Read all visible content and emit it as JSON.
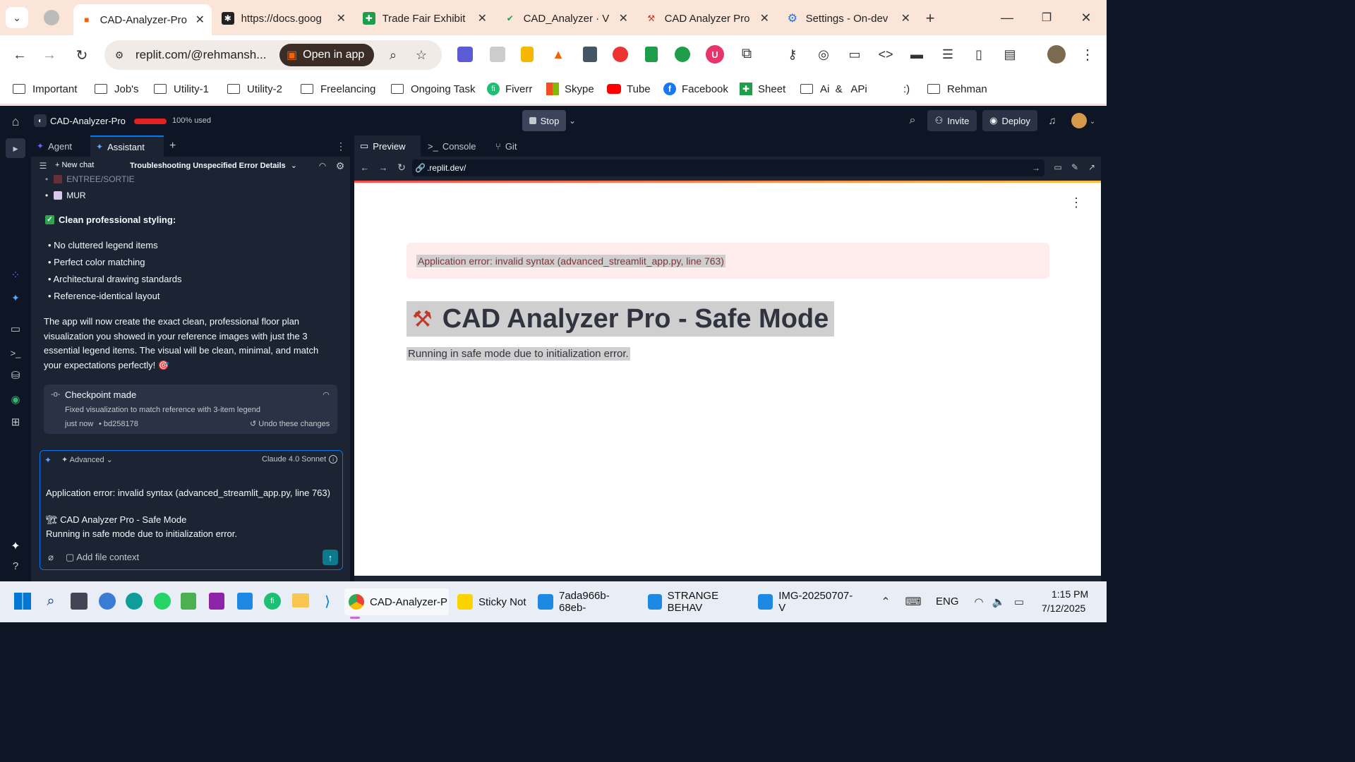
{
  "browser": {
    "tabs": [
      {
        "title": "CAD-Analyzer-Pro",
        "favicon": "replit-icon",
        "active": true
      },
      {
        "title": "https://docs.goog",
        "favicon": "dots-icon"
      },
      {
        "title": "Trade Fair Exhibit",
        "favicon": "sheets-icon"
      },
      {
        "title": "CAD_Analyzer · V",
        "favicon": "check-icon"
      },
      {
        "title": "CAD Analyzer Pro",
        "favicon": "crane-icon"
      },
      {
        "title": "Settings - On-dev",
        "favicon": "gear-icon"
      }
    ],
    "url": "replit.com/@rehmansh...",
    "open_in_app": "Open in app",
    "bookmarks": [
      {
        "label": "Important",
        "icon": "folder-icon"
      },
      {
        "label": "Job's",
        "icon": "folder-icon"
      },
      {
        "label": "Utility-1",
        "icon": "folder-icon"
      },
      {
        "label": "Utility-2",
        "icon": "folder-icon"
      },
      {
        "label": "Freelancing",
        "icon": "folder-icon"
      },
      {
        "label": "Ongoing Task",
        "icon": "folder-icon"
      },
      {
        "label": "Fiverr",
        "icon": "fiverr-icon"
      },
      {
        "label": "Skype",
        "icon": "windows-icon"
      },
      {
        "label": "Tube",
        "icon": "youtube-icon"
      },
      {
        "label": "Facebook",
        "icon": "facebook-icon"
      },
      {
        "label": "Sheet",
        "icon": "sheets-icon"
      },
      {
        "label": "Ai  &   APi",
        "icon": "folder-icon"
      },
      {
        "label": ":)",
        "icon": ""
      },
      {
        "label": "Rehman",
        "icon": "folder-icon"
      }
    ]
  },
  "replit": {
    "project": "CAD-Analyzer-Pro",
    "usage": "100% used",
    "stop": "Stop",
    "invite": "Invite",
    "deploy": "Deploy",
    "left_tabs": {
      "agent": "Agent",
      "assistant": "Assistant",
      "add": "+"
    },
    "new_chat": "+ New chat",
    "chat_title": "Troubleshooting Unspecified Error Details",
    "chat": {
      "list_top": [
        "ENTREE/SORTIE",
        "MUR"
      ],
      "styling_heading": "Clean professional styling:",
      "styling_items": [
        "No cluttered legend items",
        "Perfect color matching",
        "Architectural drawing standards",
        "Reference-identical layout"
      ],
      "paragraph": "The app will now create the exact clean, professional floor plan visualization you showed in your reference images with just the 3 essential legend items. The visual will be clean, minimal, and match your expectations perfectly! 🎯",
      "checkpoint_title": "Checkpoint made",
      "checkpoint_desc": "Fixed visualization to match reference with 3-item legend",
      "checkpoint_time": "just now",
      "checkpoint_hash": "• bd258178",
      "undo": "Undo these changes"
    },
    "composer": {
      "mode": "Advanced",
      "model": "Claude 4.0 Sonnet",
      "line1": "Application error: invalid syntax (advanced_streamlit_app.py, line 763)",
      "line2": "🏗 CAD Analyzer Pro - Safe Mode",
      "line3": "Running in safe mode due to initialization error.",
      "add_context": "Add file context"
    },
    "right_tabs": {
      "preview": "Preview",
      "console": "Console",
      "git": "Git"
    },
    "preview_url": ".replit.dev/",
    "preview": {
      "error": "Application error: invalid syntax (advanced_streamlit_app.py, line 763)",
      "title": "CAD Analyzer Pro - Safe Mode",
      "subtitle": "Running in safe mode due to initialization error."
    }
  },
  "taskbar": {
    "apps": [
      {
        "label": "CAD-Analyzer-P",
        "icon": "chrome-icon"
      },
      {
        "label": "Sticky Not",
        "icon": "sticky-notes-icon"
      },
      {
        "label": "7ada966b-68eb-",
        "icon": "photos-icon"
      },
      {
        "label": "STRANGE BEHAV",
        "icon": "photos-icon"
      },
      {
        "label": "IMG-20250707-V",
        "icon": "photos-icon"
      }
    ],
    "lang": "ENG",
    "time": "1:15 PM",
    "date": "7/12/2025"
  },
  "colors": {
    "accent": "#0079f2",
    "danger": "#e52222",
    "error_bg": "#ffecec"
  }
}
